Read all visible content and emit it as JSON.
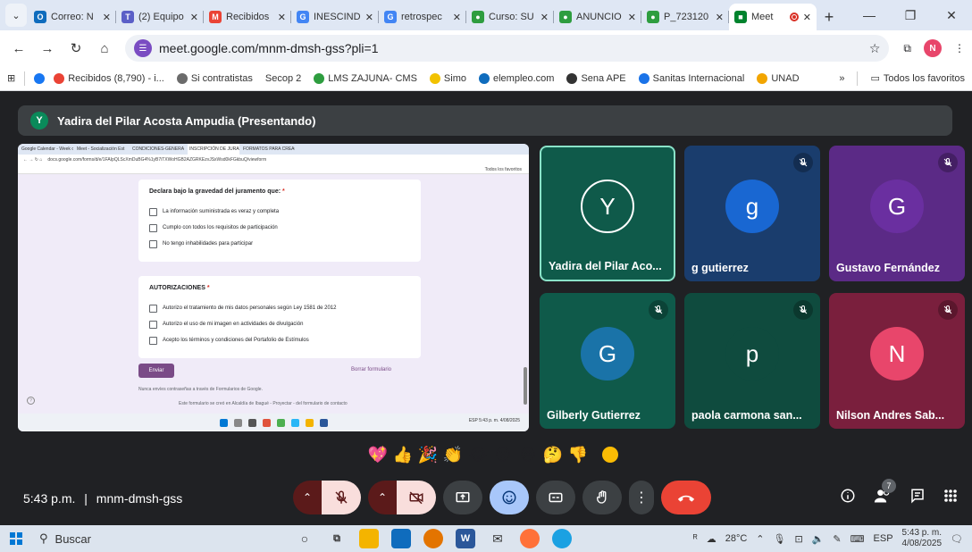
{
  "browser": {
    "tabs": [
      {
        "title": "Correo: N",
        "color": "#0f6cbd",
        "glyph": "O"
      },
      {
        "title": "(2) Equipo",
        "color": "#5b5fc7",
        "glyph": "T"
      },
      {
        "title": "Recibidos",
        "color": "#ea4335",
        "glyph": "M"
      },
      {
        "title": "INESCIND",
        "color": "#4285f4",
        "glyph": "G"
      },
      {
        "title": "retrospec",
        "color": "#4285f4",
        "glyph": "G"
      },
      {
        "title": "Curso: SU",
        "color": "#2e9d3f",
        "glyph": "●"
      },
      {
        "title": "ANUNCIO",
        "color": "#2e9d3f",
        "glyph": "●"
      },
      {
        "title": "P_723120",
        "color": "#2e9d3f",
        "glyph": "●"
      },
      {
        "title": "Meet",
        "color": "#00832d",
        "glyph": "■"
      }
    ],
    "url": "meet.google.com/mnm-dmsh-gss?pli=1",
    "bookmarks": [
      {
        "label": "Recibidos (8,790) - i...",
        "color": "#ea4335"
      },
      {
        "label": "Si contratistas",
        "color": "#6b6b6b"
      },
      {
        "label": "Secop 2",
        "color": ""
      },
      {
        "label": "LMS ZAJUNA- CMS",
        "color": "#2e9d3f"
      },
      {
        "label": "Simo",
        "color": "#f2c200"
      },
      {
        "label": "elempleo.com",
        "color": "#0f6cbd"
      },
      {
        "label": "Sena APE",
        "color": "#333333"
      },
      {
        "label": "Sanitas Internacional",
        "color": "#1a73e8"
      },
      {
        "label": "UNAD",
        "color": "#f2a500"
      }
    ],
    "all_bookmarks": "Todos los favoritos",
    "profile_initial": "N"
  },
  "meet": {
    "presenter_initial": "Y",
    "presenter_label": "Yadira del Pilar Acosta Ampudia (Presentando)",
    "shared_screen": {
      "tabs": [
        "Google Calendar - Week of",
        "Meet - Socialización Est",
        "CONDICIONES-GENERALES",
        "INSCRIPCIÓN DE JURADOS",
        "FORMATOS PARA CREACIÓ"
      ],
      "url": "docs.google.com/forms/d/e/1FAIpQLScXmDuBG4%1yB7iTXWoHGB2AZGRKEzvJSxWsd0kFGkbuQ/viewform",
      "bookmarks": "Todos los favoritos",
      "section1_title": "Declara bajo la gravedad del juramento que:",
      "section1_options": [
        "La información suministrada es veraz y completa",
        "Cumplo con todos los requisitos de participación",
        "No tengo inhabilidades para participar"
      ],
      "section2_title": "AUTORIZACIONES",
      "section2_options": [
        "Autorizo el tratamiento de mis datos personales según Ley 1581 de 2012",
        "Autorizo el uso de mi imagen en actividades de divulgación",
        "Acepto los términos y condiciones del Portafolio de Estímulos"
      ],
      "required_mark": "*",
      "send": "Enviar",
      "clear": "Borrar formulario",
      "footer1": "Nunca envíes contraseñas a través de Formularios de Google.",
      "footer2": "Este formulario se creó en Alcaldía de Ibagué - Proyectar - del formulario de contacto",
      "taskbar_time": "5:43 p. m.",
      "taskbar_date": "4/08/2025",
      "taskbar_lang": "ESP"
    },
    "participants": [
      {
        "initial": "Y",
        "name": "Yadira del Pilar Aco...",
        "bg": "#0f5a4a",
        "avatar": "#0f5a4a",
        "muted": false,
        "speaking": true
      },
      {
        "initial": "g",
        "name": "g gutierrez",
        "bg": "#1a3d6d",
        "avatar": "#1967d2",
        "muted": true,
        "speaking": false
      },
      {
        "initial": "G",
        "name": "Gustavo Fernández",
        "bg": "#5b2a86",
        "avatar": "#6a2fa0",
        "muted": true,
        "speaking": false
      },
      {
        "initial": "G",
        "name": "Gilberly Gutierrez",
        "bg": "#0f5a4a",
        "avatar": "#1a73a8",
        "muted": true,
        "speaking": false
      },
      {
        "initial": "p",
        "name": "paola carmona san...",
        "bg": "#0f4b3e",
        "avatar": "#0f4b3e",
        "muted": true,
        "speaking": false
      },
      {
        "initial": "N",
        "name": "Nilson Andres Sab...",
        "bg": "#7a1f3d",
        "avatar": "#e8466b",
        "muted": true,
        "speaking": false
      }
    ],
    "reactions": [
      "💖",
      "👍",
      "🎉",
      "👏",
      "😂",
      "😮",
      "😢",
      "🤔",
      "👎"
    ],
    "time": "5:43 p.m.",
    "meeting_code": "mnm-dmsh-gss",
    "people_count": "7"
  },
  "taskbar": {
    "search": "Buscar",
    "weather": "28°C",
    "lang": "ESP",
    "time": "5:43 p. m.",
    "date": "4/08/2025"
  }
}
